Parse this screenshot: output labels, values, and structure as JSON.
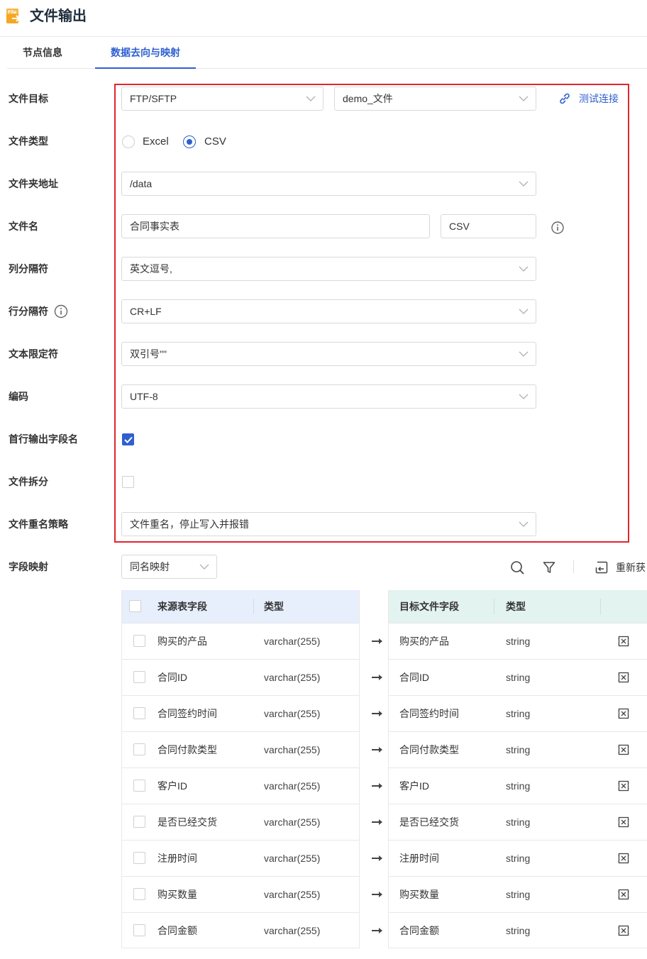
{
  "header": {
    "title": "文件输出",
    "icon": "file-output-icon",
    "icon_text": "File"
  },
  "tabs": [
    {
      "label": "节点信息",
      "active": false
    },
    {
      "label": "数据去向与映射",
      "active": true
    }
  ],
  "form": {
    "target": {
      "label": "文件目标",
      "protocol": "FTP/SFTP",
      "connection": "demo_文件",
      "test_link": "测试连接"
    },
    "file_type": {
      "label": "文件类型",
      "options": [
        "Excel",
        "CSV"
      ],
      "selected": "CSV"
    },
    "folder": {
      "label": "文件夹地址",
      "value": "/data"
    },
    "file_name": {
      "label": "文件名",
      "value": "合同事实表",
      "extension": "CSV"
    },
    "column_sep": {
      "label": "列分隔符",
      "value": "英文逗号,"
    },
    "row_sep": {
      "label": "行分隔符",
      "value": "CR+LF"
    },
    "text_qualifier": {
      "label": "文本限定符",
      "value": "双引号\"\""
    },
    "encoding": {
      "label": "编码",
      "value": "UTF-8"
    },
    "header_row": {
      "label": "首行输出字段名",
      "checked": true
    },
    "split": {
      "label": "文件拆分",
      "checked": false
    },
    "rename": {
      "label": "文件重名策略",
      "value": "文件重名，停止写入并报错"
    },
    "mapping": {
      "label": "字段映射",
      "mode": "同名映射",
      "refresh": "重新获"
    }
  },
  "mapping_table": {
    "source_headers": {
      "field": "来源表字段",
      "type": "类型"
    },
    "target_headers": {
      "field": "目标文件字段",
      "type": "类型"
    },
    "rows": [
      {
        "source": "购买的产品",
        "source_type": "varchar(255)",
        "target": "购买的产品",
        "target_type": "string"
      },
      {
        "source": "合同ID",
        "source_type": "varchar(255)",
        "target": "合同ID",
        "target_type": "string"
      },
      {
        "source": "合同签约时间",
        "source_type": "varchar(255)",
        "target": "合同签约时间",
        "target_type": "string"
      },
      {
        "source": "合同付款类型",
        "source_type": "varchar(255)",
        "target": "合同付款类型",
        "target_type": "string"
      },
      {
        "source": "客户ID",
        "source_type": "varchar(255)",
        "target": "客户ID",
        "target_type": "string"
      },
      {
        "source": "是否已经交货",
        "source_type": "varchar(255)",
        "target": "是否已经交货",
        "target_type": "string"
      },
      {
        "source": "注册时间",
        "source_type": "varchar(255)",
        "target": "注册时间",
        "target_type": "string"
      },
      {
        "source": "购买数量",
        "source_type": "varchar(255)",
        "target": "购买数量",
        "target_type": "string"
      },
      {
        "source": "合同金额",
        "source_type": "varchar(255)",
        "target": "合同金额",
        "target_type": "string"
      }
    ]
  },
  "colors": {
    "primary": "#2f5fd0",
    "highlight_border": "#e0262d",
    "source_header_bg": "#e7eefc",
    "target_header_bg": "#e3f3ef"
  }
}
